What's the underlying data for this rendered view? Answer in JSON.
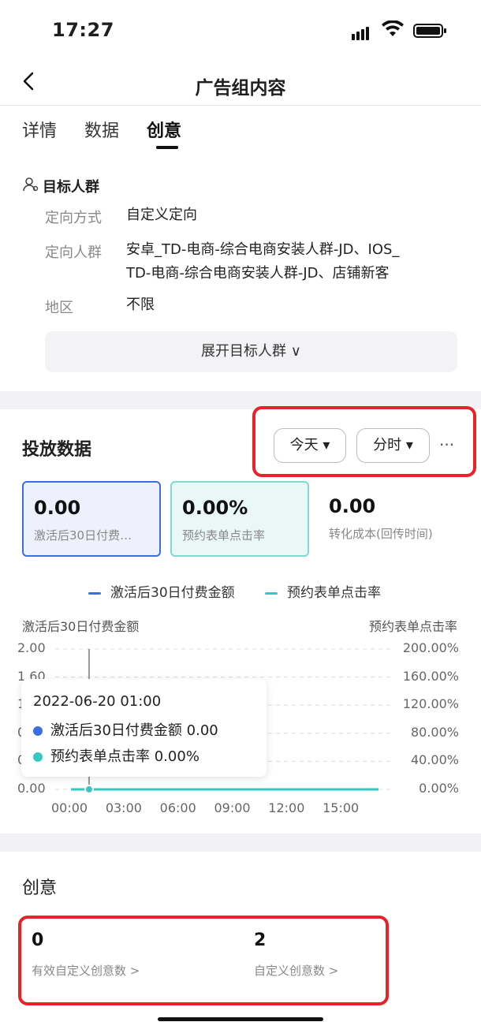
{
  "status_bar": {
    "time": "17:27"
  },
  "nav": {
    "title": "广告组内容",
    "back_icon": "chevron-left-icon"
  },
  "tabs": [
    {
      "label": "详情",
      "active": false
    },
    {
      "label": "数据",
      "active": false
    },
    {
      "label": "创意",
      "active": true
    }
  ],
  "audience": {
    "title": "目标人群",
    "rows": [
      {
        "label": "定向方式",
        "value": "自定义定向"
      },
      {
        "label": "定向人群",
        "value_line1": "安卓_TD-电商-综合电商安装人群-JD、IOS_",
        "value_line2": "TD-电商-综合电商安装人群-JD、店铺新客"
      },
      {
        "label": "地区",
        "value": "不限"
      }
    ],
    "expand_label": "展开目标人群 ∨"
  },
  "delivery_data": {
    "title": "投放数据",
    "date_filter": "今天 ▾",
    "granularity_filter": "分时 ▾",
    "more_icon": "···",
    "metrics": [
      {
        "value": "0.00",
        "label": "激活后30日付费…",
        "selected": true,
        "color": "#3b6fe0"
      },
      {
        "value": "0.00%",
        "label": "预约表单点击率",
        "selected": true,
        "color": "#36c8c0"
      },
      {
        "value": "0.00",
        "label": "转化成本(回传时间)",
        "selected": false
      }
    ],
    "tooltip": {
      "time": "2022-06-20 01:00",
      "rows": [
        {
          "name": "激活后30日付费金额",
          "value": "0.00"
        },
        {
          "name": "预约表单点击率",
          "value": "0.00%"
        }
      ]
    }
  },
  "chart_data": {
    "type": "line",
    "x": [
      "00:00",
      "01:00",
      "02:00",
      "03:00",
      "04:00",
      "05:00",
      "06:00",
      "07:00",
      "08:00",
      "09:00",
      "10:00",
      "11:00",
      "12:00",
      "13:00",
      "14:00",
      "15:00",
      "16:00",
      "17:00"
    ],
    "xticks": [
      "00:00",
      "03:00",
      "06:00",
      "09:00",
      "12:00",
      "15:00"
    ],
    "series": [
      {
        "name": "激活后30日付费金额",
        "axis": "left",
        "color": "#3b6fe0",
        "values": [
          0,
          0,
          0,
          0,
          0,
          0,
          0,
          0,
          0,
          0,
          0,
          0,
          0,
          0,
          0,
          0,
          0,
          0
        ]
      },
      {
        "name": "预约表单点击率",
        "axis": "right",
        "color": "#36c8c0",
        "values": [
          0,
          0,
          0,
          0,
          0,
          0,
          0,
          0,
          0,
          0,
          0,
          0,
          0,
          0,
          0,
          0,
          0,
          0
        ]
      }
    ],
    "ylabel_left": "激活后30日付费金额",
    "ylabel_right": "预约表单点击率",
    "yticks_left": [
      "2.00",
      "1.60",
      "1.20",
      "0.80",
      "0.40",
      "0.00"
    ],
    "yticks_right": [
      "200.00%",
      "160.00%",
      "120.00%",
      "80.00%",
      "40.00%",
      "0.00%"
    ],
    "ylim_left": [
      0,
      2
    ],
    "ylim_right": [
      0,
      200
    ],
    "highlight_x": "01:00",
    "grid": true,
    "legend": "top"
  },
  "creative": {
    "title": "创意",
    "stats": [
      {
        "value": "0",
        "label": "有效自定义创意数 >"
      },
      {
        "value": "2",
        "label": "自定义创意数 >"
      }
    ]
  }
}
